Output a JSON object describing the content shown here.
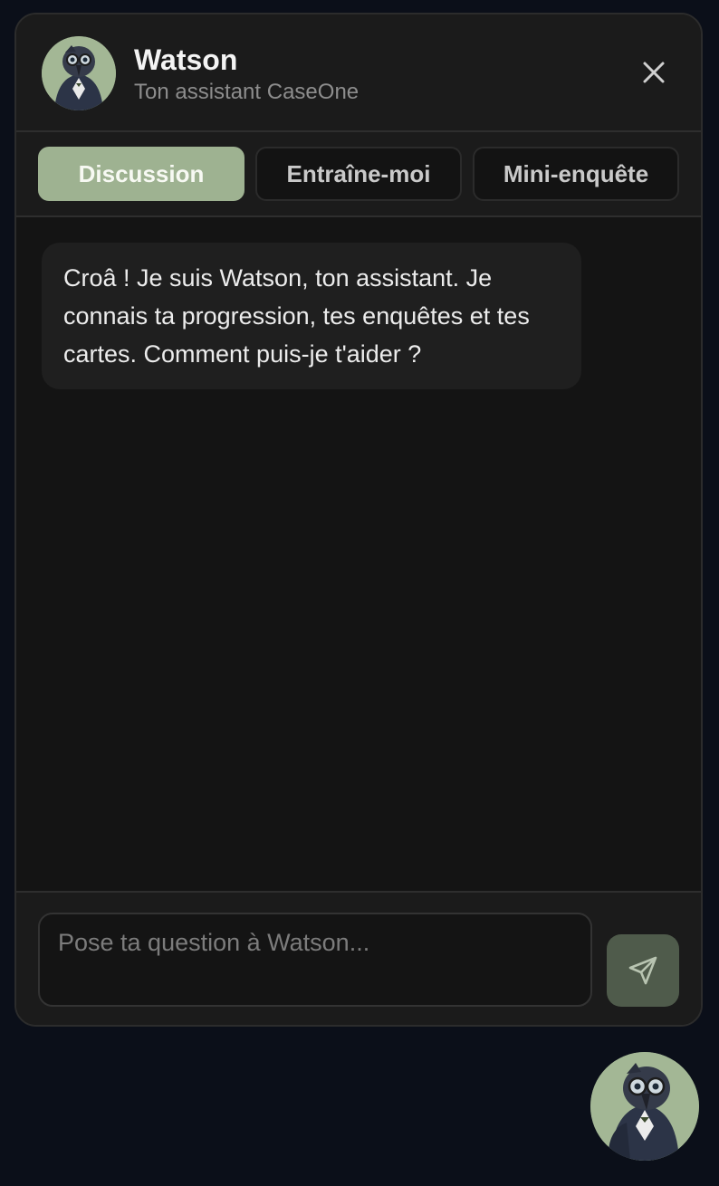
{
  "header": {
    "title": "Watson",
    "subtitle": "Ton assistant CaseOne",
    "avatar_icon": "raven-detective-avatar",
    "close_icon": "close-icon"
  },
  "tabs": [
    {
      "label": "Discussion",
      "active": true
    },
    {
      "label": "Entraîne-moi",
      "active": false
    },
    {
      "label": "Mini-enquête",
      "active": false
    }
  ],
  "messages": [
    {
      "from": "assistant",
      "text": "Croâ ! Je suis Watson, ton assistant. Je connais ta progression, tes enquêtes et tes cartes. Comment puis-je t'aider ?"
    }
  ],
  "composer": {
    "placeholder": "Pose ta question à Watson...",
    "value": "",
    "send_icon": "send-icon"
  },
  "launcher": {
    "icon": "raven-detective-avatar"
  },
  "colors": {
    "accent": "#9eb291",
    "panel_bg": "#141414",
    "header_bg": "#1b1b1b",
    "page_bg": "#0b0f19",
    "send_button_bg": "#4f5b4b"
  }
}
